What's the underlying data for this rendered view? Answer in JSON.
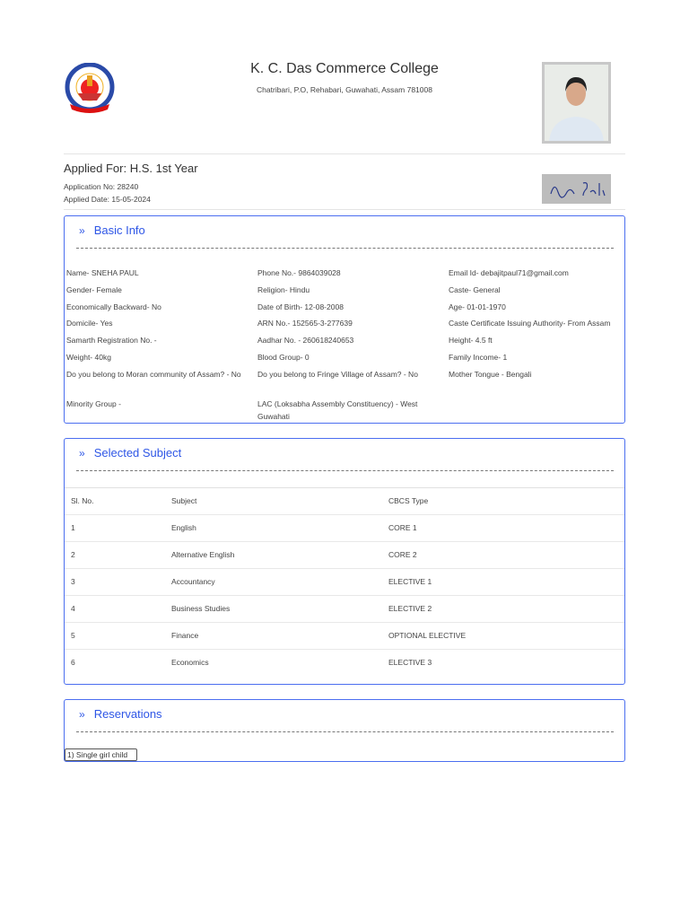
{
  "header": {
    "college_name": "K. C. Das Commerce College",
    "address": "Chatribari, P.O, Rehabari, Guwahati, Assam 781008"
  },
  "application": {
    "applied_for": "Applied For: H.S. 1st Year",
    "application_no": "Application No: 28240",
    "applied_date": "Applied Date: 15-05-2024"
  },
  "basic_info": {
    "title": "Basic Info",
    "fields": [
      [
        "Name- SNEHA PAUL",
        "Phone No.- 9864039028",
        "Email Id- debajitpaul71@gmail.com"
      ],
      [
        "Gender- Female",
        "Religion- Hindu",
        "Caste- General"
      ],
      [
        "Economically Backward- No",
        "Date of Birth- 12-08-2008",
        "Age- 01-01-1970"
      ],
      [
        "Domicile- Yes",
        "ARN No.- 152565-3-277639",
        "Caste Certificate Issuing Authority- From Assam"
      ],
      [
        "Samarth Registration No. -",
        "Aadhar No. - 260618240653",
        "Height- 4.5 ft"
      ],
      [
        "Weight- 40kg",
        "Blood Group- 0",
        "Family Income- 1"
      ],
      [
        "Do you belong to Moran community of Assam? - No",
        "Do you belong to Fringe Village of Assam? - No",
        "Mother Tongue - Bengali"
      ],
      [
        "Minority Group -",
        "LAC (Loksabha Assembly Constituency) - West Guwahati",
        ""
      ]
    ]
  },
  "selected_subject": {
    "title": "Selected Subject",
    "headers": [
      "Sl. No.",
      "Subject",
      "CBCS Type"
    ],
    "rows": [
      [
        "1",
        "English",
        "CORE 1"
      ],
      [
        "2",
        "Alternative English",
        "CORE 2"
      ],
      [
        "3",
        "Accountancy",
        "ELECTIVE 1"
      ],
      [
        "4",
        "Business Studies",
        "ELECTIVE 2"
      ],
      [
        "5",
        "Finance",
        "OPTIONAL ELECTIVE"
      ],
      [
        "6",
        "Economics",
        "ELECTIVE 3"
      ]
    ]
  },
  "reservations": {
    "title": "Reservations",
    "items": [
      "1) Single girl child"
    ]
  },
  "icons": {
    "section": "chevron-double-right-icon"
  },
  "colors": {
    "accent": "#2e56e6",
    "border": "#4b6ef0"
  }
}
